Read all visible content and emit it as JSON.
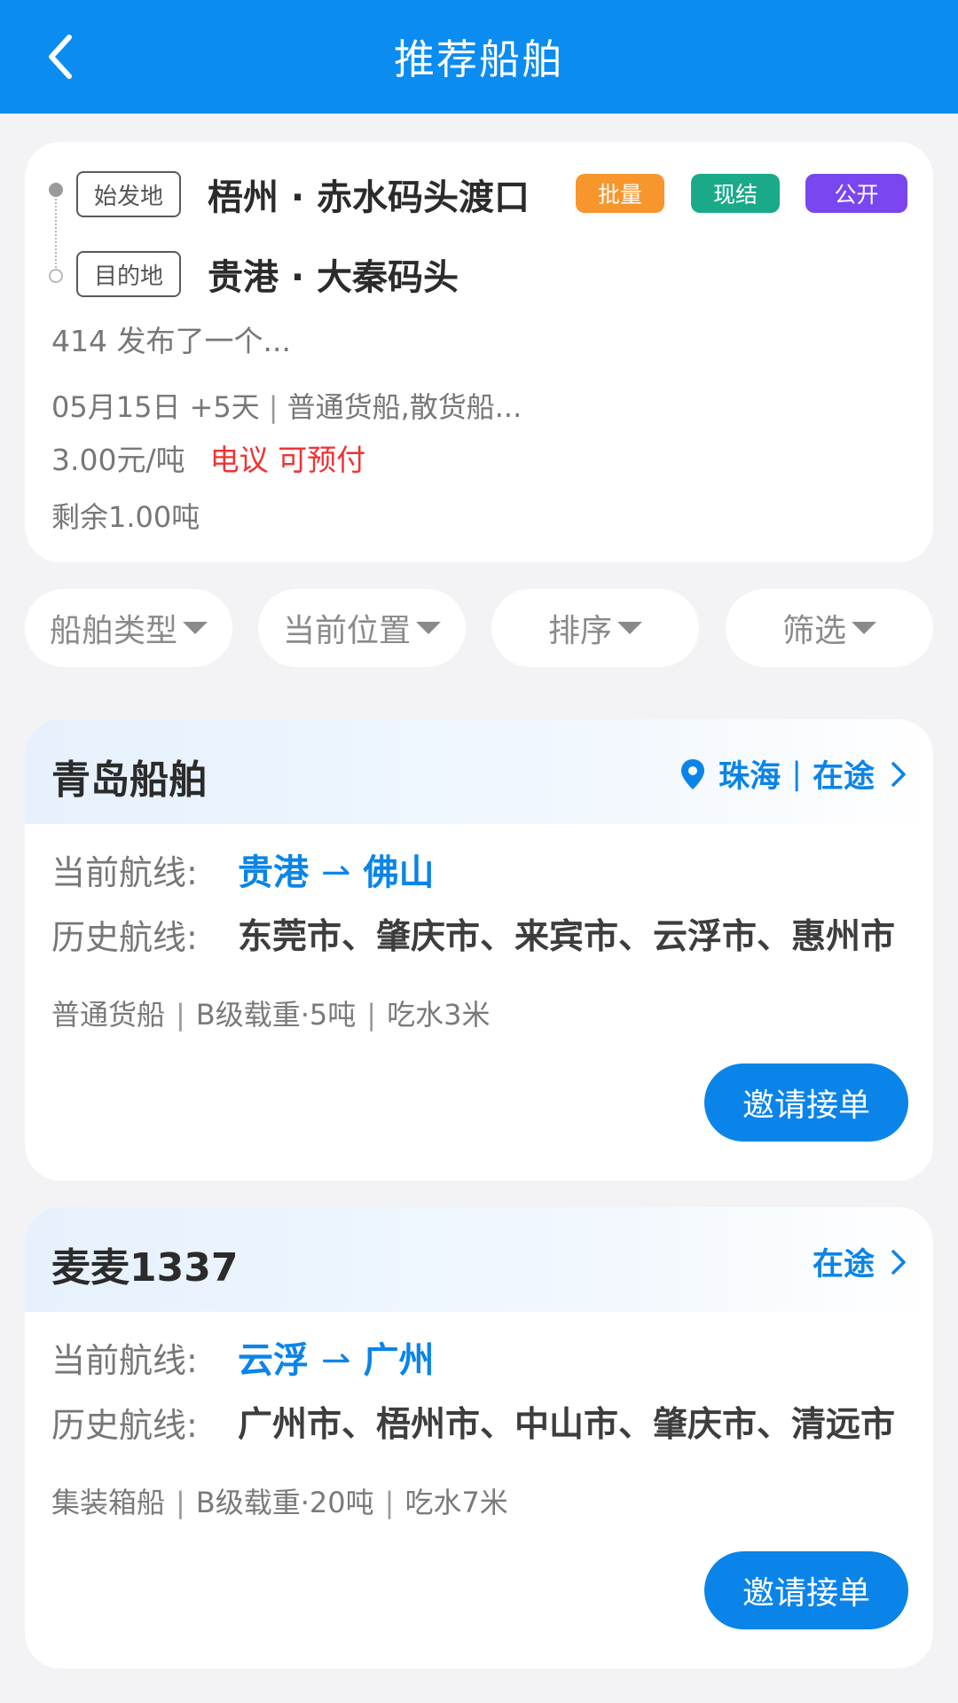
{
  "nav": {
    "title": "推荐船舶",
    "back_icon": "chevron-left-icon"
  },
  "colors": {
    "primary": "#0a8cf0",
    "accent_blue": "#0a84e8",
    "price_red": "#f03232",
    "badge_batch": "#f7962c",
    "badge_cash": "#1aaa8a",
    "badge_public": "#7a46f0"
  },
  "cargo": {
    "origin_tag": "始发地",
    "origin": "梧州 · 赤水码头渡口",
    "dest_tag": "目的地",
    "dest": "贵港 · 大秦码头",
    "badges": [
      "批量",
      "现结",
      "公开"
    ],
    "publisher": "414 发布了一个...",
    "date": "05月15日 +5天",
    "ship_types": "普通货船,散货船...",
    "price": "3.00元/吨",
    "price_note": "电议 可预付",
    "remaining": "剩余1.00吨"
  },
  "filters": [
    {
      "label": "船舶类型"
    },
    {
      "label": "当前位置"
    },
    {
      "label": "排序"
    },
    {
      "label": "筛选"
    }
  ],
  "ships": [
    {
      "name": "青岛船舶",
      "location": "珠海",
      "status": "在途",
      "current_label": "当前航线:",
      "current_from": "贵港",
      "current_arrow": "⇀",
      "current_to": "佛山",
      "history_label": "历史航线:",
      "history": "东莞市、肇庆市、来宾市、云浮市、惠州市",
      "type": "普通货船",
      "load": "B级载重·5吨",
      "draft": "吃水3米",
      "button": "邀请接单"
    },
    {
      "name": "麦麦1337",
      "status": "在途",
      "current_label": "当前航线:",
      "current_from": "云浮",
      "current_arrow": "⇀",
      "current_to": "广州",
      "history_label": "历史航线:",
      "history": "广州市、梧州市、中山市、肇庆市、清远市",
      "type": "集装箱船",
      "load": "B级载重·20吨",
      "draft": "吃水7米",
      "button": "邀请接单"
    }
  ]
}
